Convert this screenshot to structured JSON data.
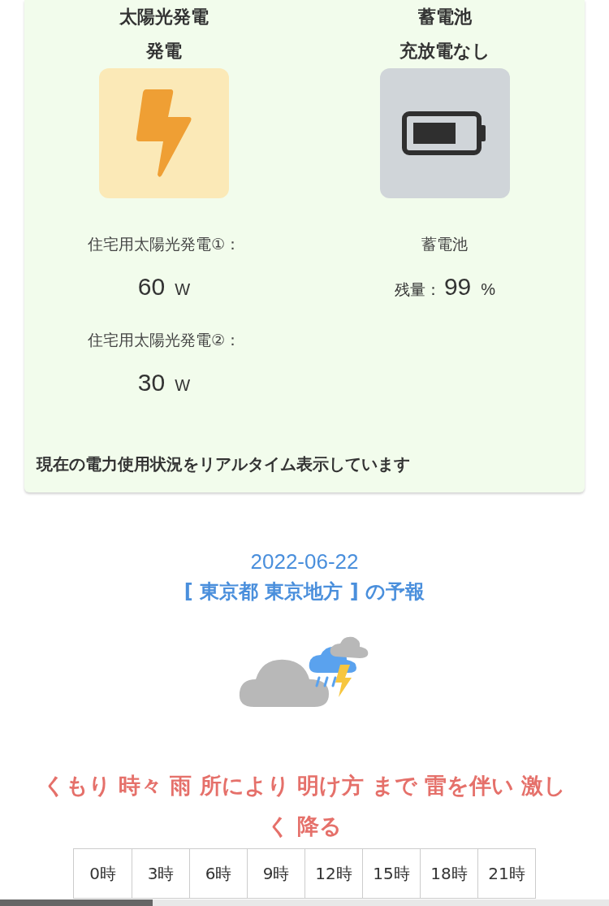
{
  "status_card": {
    "columns": [
      {
        "kind": "solar",
        "title": "太陽光発電",
        "state": "発電",
        "readings": [
          {
            "label": "住宅用太陽光発電①：",
            "value": "60",
            "unit": "W"
          },
          {
            "label": "住宅用太陽光発電②：",
            "value": "30",
            "unit": "W"
          }
        ]
      },
      {
        "kind": "battery",
        "title": "蓄電池",
        "state": "充放電なし",
        "readings": [
          {
            "label": "蓄電池"
          },
          {
            "prefix": "残量：",
            "value": "99",
            "unit": "%"
          }
        ]
      }
    ],
    "footer": "現在の電力使用状況をリアルタイム表示しています"
  },
  "forecast": {
    "date": "2022-06-22",
    "area": "[ 東京都 東京地方 ] の予報",
    "summary": "くもり 時々 雨 所により 明け方 まで 雷を伴い 激しく 降る",
    "table": {
      "columns": [
        "0時",
        "3時",
        "6時",
        "9時",
        "12時",
        "15時",
        "18時",
        "21時"
      ]
    }
  }
}
